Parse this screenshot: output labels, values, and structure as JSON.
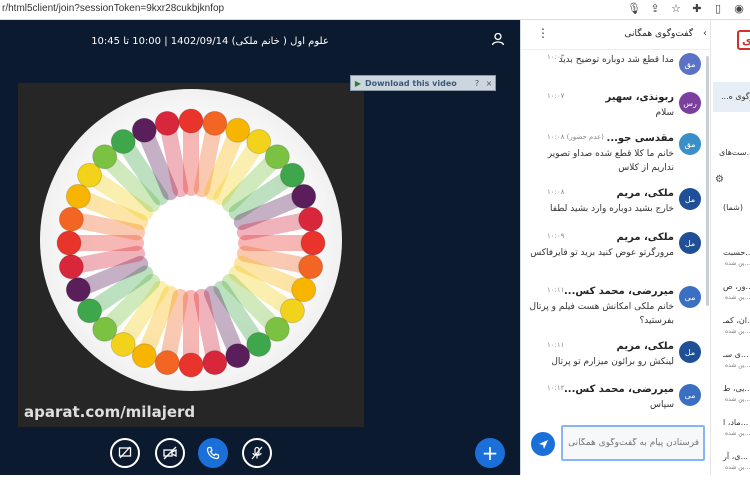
{
  "browser": {
    "url": "r/html5client/join?sessionToken=9kxr28cukbjknfop"
  },
  "meeting": {
    "title": "علوم اول ( خانم ملکی) 1402/09/14 | 10:00 تا 10:45"
  },
  "video": {
    "watermark": "aparat.com/milajerd",
    "download_label": "Download this video",
    "help_label": "?",
    "close_label": "×"
  },
  "controls": [
    {
      "name": "screen-share-button",
      "icon": "screen-share-icon"
    },
    {
      "name": "camera-off-button",
      "icon": "camera-off-icon"
    },
    {
      "name": "phone-button",
      "icon": "phone-icon"
    },
    {
      "name": "mic-off-button",
      "icon": "mic-off-icon"
    }
  ],
  "chat": {
    "title": "گفت‌وگوی همگانی",
    "messages": [
      {
        "sender": "",
        "initials": "مق",
        "color": "#5b73c7",
        "time": "۱۰:۰۳",
        "status": "",
        "body": "مدا قطع شد دوباره توضیح بدید"
      },
      {
        "sender": "ربونذی، سهیر",
        "initials": "رس",
        "color": "#7b3fa0",
        "time": "۱۰:۰۷",
        "status": "",
        "body": "سلام"
      },
      {
        "sender": "مقدسی جو...",
        "initials": "مق",
        "color": "#3a8fc9",
        "time": "۱۰:۰۸",
        "status": "(عدم حضور)",
        "body": "خانم ما کلا قطع شده صداو تصویر نداریم از کلاس"
      },
      {
        "sender": "ملکی، مریم",
        "initials": "مل",
        "color": "#1f4f96",
        "time": "۱۰:۰۸",
        "status": "",
        "body": "خارج بشید دوباره وارد بشید لطفا"
      },
      {
        "sender": "ملکی، مریم",
        "initials": "مل",
        "color": "#1f4f96",
        "time": "۱۰:۰۹",
        "status": "",
        "body": "مرورگرتو عوض کنید برید تو فایرفاکس"
      },
      {
        "sender": "میررضی، محمد کس...",
        "initials": "می",
        "color": "#3b6fc2",
        "time": "۱۰:۱۱",
        "status": "",
        "body": "خانم ملکی امکانش هست فیلم و پرتال بفرستید؟"
      },
      {
        "sender": "ملکی، مریم",
        "initials": "مل",
        "color": "#1f4f96",
        "time": "۱۰:۱۱",
        "status": "",
        "body": "لینکش رو برائون میزارم تو پرتال"
      },
      {
        "sender": "میررضی، محمد کس...",
        "initials": "می",
        "color": "#3b6fc2",
        "time": "۱۰:۱۲",
        "status": "",
        "body": "سپاس"
      }
    ],
    "composer_placeholder": "فرستادن پیام به گفت‌وگوی همگانی"
  },
  "side": {
    "logo": "ی",
    "item_active": "گفت‌وگوی ه...",
    "item2": "...ست‌های",
    "item3": "(شما)",
    "items": [
      {
        "label": "...حسبت",
        "sub": "...ین شده"
      },
      {
        "label": "...ور، ص",
        "sub": "...ین شده"
      },
      {
        "label": "...ان، کمـ",
        "sub": "...ین شده"
      },
      {
        "label": "...ی سـ",
        "sub": "...ین شده"
      },
      {
        "label": "...یی، ط",
        "sub": "...ین شده"
      },
      {
        "label": "...ماد، ا",
        "sub": "...ین شده"
      },
      {
        "label": "...ی، آر",
        "sub": "...ین شده"
      }
    ]
  }
}
